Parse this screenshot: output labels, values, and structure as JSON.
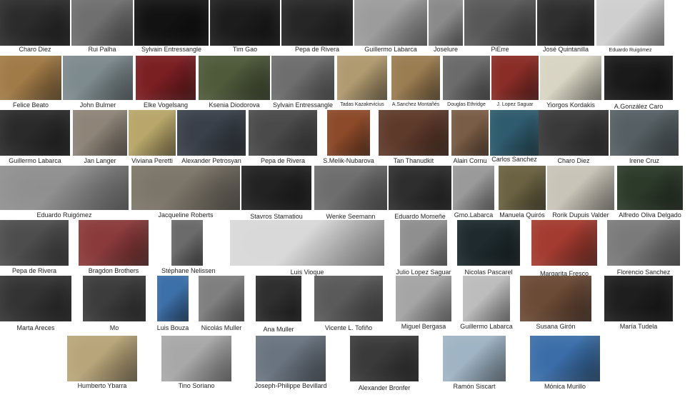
{
  "photos": [
    {
      "name": "Charo Diez",
      "tone": "#2b2b2b"
    },
    {
      "name": "Rui Palha",
      "tone": "#6f6f6f"
    },
    {
      "name": "Sylvain Entressangle",
      "tone": "#121212"
    },
    {
      "name": "Tim  Gao",
      "tone": "#1c1c1c"
    },
    {
      "name": "Pepa de Rivera",
      "tone": "#262626"
    },
    {
      "name": "Guillermo Labarca",
      "tone": "#9c9c9c"
    },
    {
      "name": "Joselure",
      "tone": "#8a8a8a"
    },
    {
      "name": "PiErre",
      "tone": "#585858"
    },
    {
      "name": "José Quintanilla",
      "tone": "#2f2f2f"
    },
    {
      "name": "Eduardo Ruigómez",
      "tone": "#cfcfcf"
    },
    {
      "name": "Felice  Beato",
      "tone": "#a07a47"
    },
    {
      "name": "John Bulmer",
      "tone": "#7d8a8e"
    },
    {
      "name": "Elke Vogelsang",
      "tone": "#7a1f22"
    },
    {
      "name": "Ksenia Diodorova",
      "tone": "#4e5a3a"
    },
    {
      "name": "Sylvain Entressangle",
      "tone": "#6e6e6e"
    },
    {
      "name": "Tadas Kazakevicius",
      "tone": "#b09a70"
    },
    {
      "name": "A.Sanchez Montañés",
      "tone": "#9b7d52"
    },
    {
      "name": "Douglas Ethridge",
      "tone": "#6b6b6b"
    },
    {
      "name": "J. Lopez Saguar",
      "tone": "#8a2d27"
    },
    {
      "name": "Yiorgos Kordakis",
      "tone": "#d9d5c4"
    },
    {
      "name": "A.González Caro",
      "tone": "#1a1a1a"
    },
    {
      "name": "Guillermo Labarca",
      "tone": "#2a2a2a"
    },
    {
      "name": "Jan Langer",
      "tone": "#8e8478"
    },
    {
      "name": "Viviana Peretti",
      "tone": "#b8a66a"
    },
    {
      "name": "Alexander Petrosyan",
      "tone": "#394049"
    },
    {
      "name": "Pepa de Rivera",
      "tone": "#4a4a4a"
    },
    {
      "name": "S.Melik-Nubarova",
      "tone": "#8c4a2a"
    },
    {
      "name": "Tan Thanudkit",
      "tone": "#5e3a2a"
    },
    {
      "name": "Alain Cornu",
      "tone": "#7a5d46"
    },
    {
      "name": "Carlos Sanchez",
      "tone": "#2f5b6e"
    },
    {
      "name": "Charo Diez",
      "tone": "#3a3a3a"
    },
    {
      "name": "Irene Cruz",
      "tone": "#566064"
    },
    {
      "name": "Eduardo Ruigómez",
      "tone": "#8e8e8e"
    },
    {
      "name": "Jacqueline Roberts",
      "tone": "#7b7468"
    },
    {
      "name": "Stavros Stamatiou",
      "tone": "#222222"
    },
    {
      "name": "Wenke Seemann",
      "tone": "#6d6d6d"
    },
    {
      "name": "Eduardo Momeñe",
      "tone": "#2e2e2e"
    },
    {
      "name": "Gmo.Labarca",
      "tone": "#9a9a9a"
    },
    {
      "name": "Manuela Quirós",
      "tone": "#6b6242"
    },
    {
      "name": "Rorik Dupuis Valder",
      "tone": "#c9c4b8"
    },
    {
      "name": "Alfredo Oliva Delgado",
      "tone": "#2c3a2a"
    },
    {
      "name": "Pepa de Rivera",
      "tone": "#4d4d4d"
    },
    {
      "name": "Bragdon Brothers",
      "tone": "#8a3a3a"
    },
    {
      "name": "Stéphane Nelissen",
      "tone": "#6b6b6b"
    },
    {
      "name": "Luis Vioque",
      "tone": "#d8d8d8"
    },
    {
      "name": "Julio Lopez Saguar",
      "tone": "#8f8f8f"
    },
    {
      "name": "Nicolas Pascarel",
      "tone": "#1e2a2e"
    },
    {
      "name": "Margarita Fresco",
      "tone": "#a33b30"
    },
    {
      "name": "Florencio Sanchez",
      "tone": "#7a7a7a"
    },
    {
      "name": "Marta Areces",
      "tone": "#333333"
    },
    {
      "name": "Mo",
      "tone": "#3c3c3c"
    },
    {
      "name": "Luis Bouza",
      "tone": "#3d6fa8"
    },
    {
      "name": "Nicolás Muller",
      "tone": "#7f7f7f"
    },
    {
      "name": "Ana Muller",
      "tone": "#2f2f2f"
    },
    {
      "name": "Vicente L. Tofiño",
      "tone": "#5a5a5a"
    },
    {
      "name": "Miguel Bergasa",
      "tone": "#a5a5a5"
    },
    {
      "name": "Guillermo Labarca",
      "tone": "#bdbdbd"
    },
    {
      "name": "Susana Girón",
      "tone": "#6b4a36"
    },
    {
      "name": "María Tudela",
      "tone": "#1e1e1e"
    },
    {
      "name": "Humberto Ybarra",
      "tone": "#b8a57a"
    },
    {
      "name": "Tino Soriano",
      "tone": "#a8a8a8"
    },
    {
      "name": "Joseph-Philippe Bevillard",
      "tone": "#6a7480"
    },
    {
      "name": "Alexander Bronfer",
      "tone": "#3a3a3a"
    },
    {
      "name": "Ramón Siscart",
      "tone": "#9fb4c4"
    },
    {
      "name": "Mónica Murillo",
      "tone": "#3b6ea8"
    }
  ]
}
